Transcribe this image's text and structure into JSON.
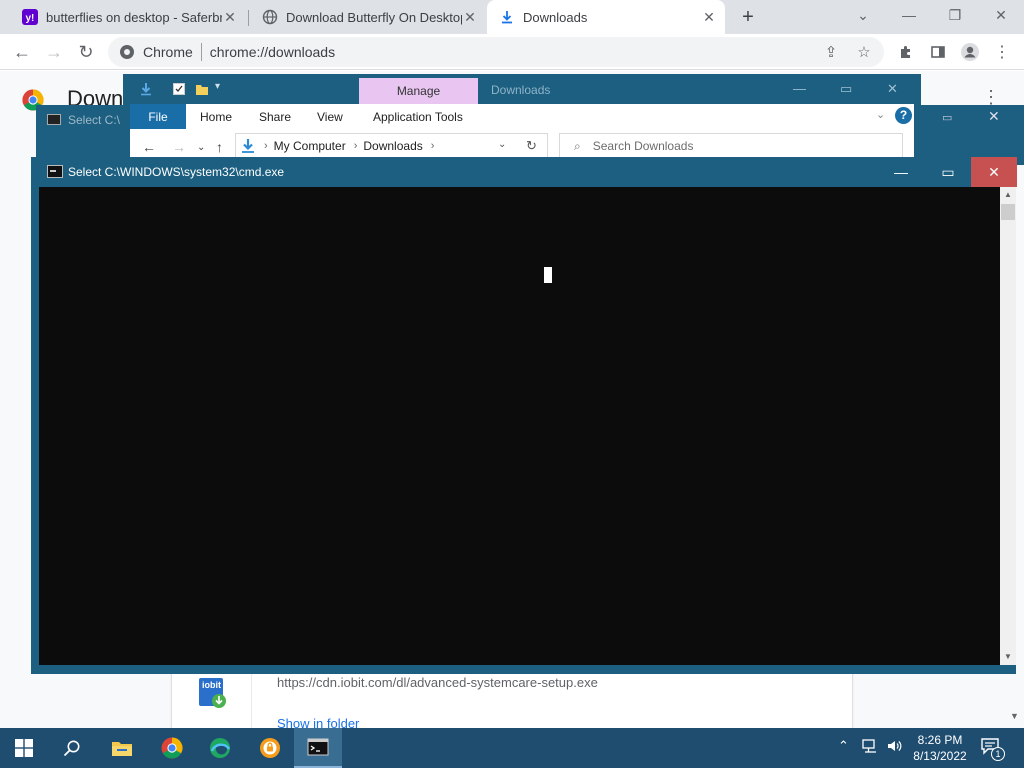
{
  "browser": {
    "tabs": [
      {
        "title": "butterflies on desktop - Saferbro",
        "favicon": "yahoo-icon",
        "active": false
      },
      {
        "title": "Download Butterfly On Desktop",
        "favicon": "globe-icon",
        "active": false
      },
      {
        "title": "Downloads",
        "favicon": "download-icon",
        "active": true
      }
    ],
    "omnibox": {
      "site_label": "Chrome",
      "url": "chrome://downloads"
    }
  },
  "downloads_page": {
    "title": "Down",
    "item": {
      "url": "https://cdn.iobit.com/dl/advanced-systemcare-setup.exe",
      "show_in_folder": "Show in folder",
      "icon_text": "iobit"
    }
  },
  "background_cmd": {
    "title": "Select C:\\"
  },
  "explorer": {
    "title": "Downloads",
    "contextual_tab": "Manage",
    "ribbon_tabs": [
      "File",
      "Home",
      "Share",
      "View",
      "Application Tools"
    ],
    "breadcrumb": [
      "My Computer",
      "Downloads"
    ],
    "search_placeholder": "Search Downloads"
  },
  "cmd": {
    "title": "Select C:\\WINDOWS\\system32\\cmd.exe",
    "content": ""
  },
  "taskbar": {
    "apps": [
      "file-explorer",
      "chrome",
      "edge",
      "avast-secure-browser",
      "command-prompt"
    ],
    "time": "8:26 PM",
    "date": "8/13/2022",
    "notification_count": "1"
  },
  "colors": {
    "cmd_title_bar": "#1c5f80",
    "cmd_close": "#c75050",
    "manage_tab": "#e9c6f2",
    "taskbar": "#1e4d70",
    "link": "#1a73e8"
  }
}
